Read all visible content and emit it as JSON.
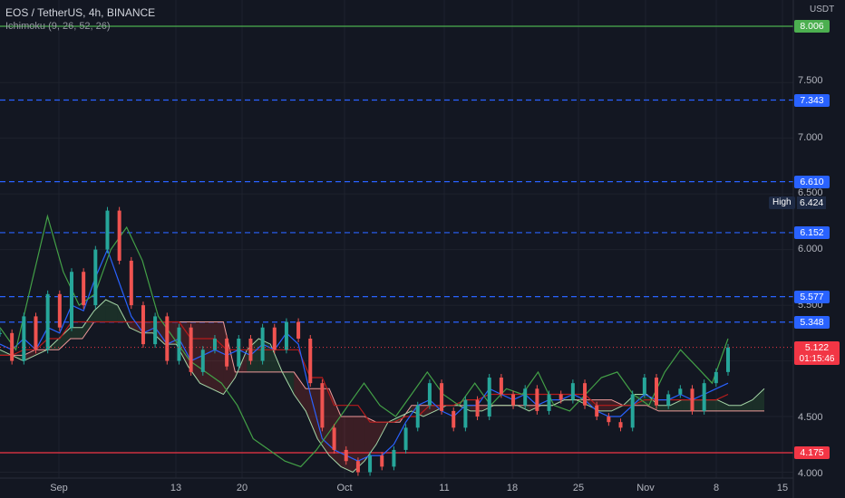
{
  "legend": {
    "symbol_line": "EOS / TetherUS, 4h, BINANCE",
    "indicator_line": "Ichimoku (9, 26, 52, 26)"
  },
  "price_scale": {
    "unit": "USDT",
    "ticks": [
      "7.500",
      "7.000",
      "6.500",
      "6.000",
      "5.500",
      "4.500",
      "4.000"
    ]
  },
  "time_scale": {
    "ticks": [
      "Sep",
      "13",
      "20",
      "Oct",
      "11",
      "18",
      "25",
      "Nov",
      "8",
      "15"
    ]
  },
  "high_marker": {
    "label": "High",
    "value": "6.424"
  },
  "last_price": {
    "value": "5.122",
    "countdown": "01:15:46"
  },
  "colors": {
    "background": "#131722",
    "blue_level": "#2962ff",
    "green_level": "#4caf50",
    "red_level": "#f23645",
    "tenkan": "#2962ff",
    "kijun": "#b71c1c",
    "chikou": "#43a047",
    "span_a": "#a5d6a7",
    "span_b": "#ef9a9a"
  },
  "chart_data": {
    "type": "line",
    "symbol": "EOS / TetherUS",
    "interval": "4h",
    "exchange": "BINANCE",
    "indicator": "Ichimoku (9, 26, 52, 26)",
    "y_unit": "USDT",
    "ylim": [
      3.98,
      8.2
    ],
    "x_ticks": [
      "Sep",
      "13",
      "20",
      "Oct",
      "11",
      "18",
      "25",
      "Nov",
      "8",
      "15"
    ],
    "grid": true,
    "horizontal_levels": [
      {
        "value": 8.006,
        "style": "solid",
        "color": "#4caf50"
      },
      {
        "value": 7.343,
        "style": "dashed",
        "color": "#2962ff"
      },
      {
        "value": 6.61,
        "style": "dashed",
        "color": "#2962ff"
      },
      {
        "value": 6.152,
        "style": "dashed",
        "color": "#2962ff"
      },
      {
        "value": 5.577,
        "style": "dashed",
        "color": "#2962ff"
      },
      {
        "value": 5.348,
        "style": "dashed",
        "color": "#2962ff"
      },
      {
        "value": 4.175,
        "style": "solid",
        "color": "#f23645"
      }
    ],
    "high": 6.424,
    "last_price": 5.122,
    "series": [
      {
        "key": "price",
        "values": [
          5.25,
          5.0,
          5.4,
          5.1,
          5.6,
          5.3,
          5.8,
          5.5,
          6.0,
          6.35,
          5.9,
          5.5,
          5.15,
          5.4,
          5.0,
          5.3,
          4.9,
          5.1,
          5.2,
          4.95,
          5.2,
          5.0,
          5.3,
          5.1,
          5.35,
          5.2,
          4.8,
          4.4,
          4.2,
          4.1,
          4.0,
          4.15,
          4.05,
          4.2,
          4.4,
          4.6,
          4.8,
          4.55,
          4.4,
          4.65,
          4.5,
          4.85,
          4.7,
          4.6,
          4.75,
          4.55,
          4.7,
          4.65,
          4.8,
          4.6,
          4.5,
          4.45,
          4.4,
          4.7,
          4.85,
          4.6,
          4.7,
          4.75,
          4.55,
          4.8,
          4.9,
          5.12
        ]
      },
      {
        "key": "tenkan",
        "values": [
          5.15,
          5.1,
          5.2,
          5.1,
          5.3,
          5.25,
          5.5,
          5.45,
          5.75,
          6.0,
          5.7,
          5.4,
          5.25,
          5.3,
          5.15,
          5.2,
          5.0,
          5.05,
          5.1,
          5.05,
          5.1,
          5.05,
          5.15,
          5.1,
          5.25,
          5.15,
          4.7,
          4.3,
          4.2,
          4.15,
          4.1,
          4.15,
          4.15,
          4.25,
          4.45,
          4.6,
          4.65,
          4.55,
          4.5,
          4.6,
          4.6,
          4.75,
          4.7,
          4.65,
          4.7,
          4.6,
          4.65,
          4.65,
          4.7,
          4.65,
          4.55,
          4.5,
          4.5,
          4.6,
          4.7,
          4.65,
          4.65,
          4.7,
          4.65,
          4.7,
          4.75,
          4.8
        ]
      },
      {
        "key": "kijun",
        "values": [
          5.05,
          5.05,
          5.1,
          5.1,
          5.2,
          5.2,
          5.35,
          5.35,
          5.35,
          5.35,
          5.35,
          5.35,
          5.35,
          5.35,
          5.35,
          5.35,
          5.2,
          5.2,
          5.2,
          5.1,
          5.1,
          5.1,
          5.1,
          5.1,
          5.1,
          5.1,
          4.85,
          4.85,
          4.6,
          4.6,
          4.6,
          4.45,
          4.45,
          4.45,
          4.5,
          4.5,
          4.6,
          4.6,
          4.6,
          4.65,
          4.65,
          4.7,
          4.7,
          4.7,
          4.7,
          4.7,
          4.7,
          4.7,
          4.7,
          4.7,
          4.6,
          4.6,
          4.6,
          4.6,
          4.65,
          4.65,
          4.65,
          4.65,
          4.65,
          4.65,
          4.65,
          4.7
        ]
      },
      {
        "key": "chikou",
        "values": [
          5.3,
          5.1,
          5.7,
          6.3,
          5.8,
          5.5,
          5.6,
          6.0,
          6.2,
          5.9,
          5.4,
          5.2,
          5.0,
          4.9,
          4.8,
          4.6,
          4.3,
          4.2,
          4.1,
          4.05,
          4.2,
          4.4,
          4.6,
          4.8,
          4.6,
          4.5,
          4.7,
          4.9,
          4.7,
          4.6,
          4.8,
          4.6,
          4.75,
          4.7,
          4.9,
          4.6,
          4.55,
          4.7,
          4.85,
          4.9,
          4.7,
          4.6,
          4.9,
          5.1,
          4.95,
          4.8,
          5.2
        ]
      },
      {
        "key": "span_a",
        "values": [
          5.1,
          5.05,
          5.0,
          5.05,
          5.1,
          5.2,
          5.3,
          5.3,
          5.45,
          5.55,
          5.5,
          5.3,
          5.25,
          5.25,
          5.15,
          5.15,
          4.95,
          4.8,
          4.75,
          4.7,
          4.85,
          5.1,
          5.2,
          5.15,
          4.9,
          4.7,
          4.55,
          4.3,
          4.15,
          4.05,
          4.0,
          4.1,
          4.25,
          4.45,
          4.5,
          4.55,
          4.5,
          4.55,
          4.6,
          4.6,
          4.55,
          4.55,
          4.6,
          4.6,
          4.6,
          4.55,
          4.6,
          4.6,
          4.65,
          4.65,
          4.6,
          4.55,
          4.55,
          4.6,
          4.7,
          4.7,
          4.6,
          4.6,
          4.65,
          4.65,
          4.65,
          4.65,
          4.6,
          4.6,
          4.65,
          4.75
        ]
      },
      {
        "key": "span_b",
        "values": [
          5.05,
          5.05,
          5.05,
          5.1,
          5.1,
          5.1,
          5.2,
          5.2,
          5.35,
          5.35,
          5.35,
          5.35,
          5.35,
          5.35,
          5.35,
          5.35,
          5.35,
          5.35,
          5.35,
          5.35,
          4.9,
          4.9,
          4.9,
          4.9,
          4.9,
          4.9,
          4.75,
          4.75,
          4.75,
          4.5,
          4.5,
          4.5,
          4.45,
          4.45,
          4.45,
          4.6,
          4.6,
          4.6,
          4.6,
          4.6,
          4.6,
          4.6,
          4.6,
          4.6,
          4.6,
          4.6,
          4.6,
          4.6,
          4.65,
          4.65,
          4.65,
          4.65,
          4.65,
          4.6,
          4.6,
          4.6,
          4.55,
          4.55,
          4.55,
          4.55,
          4.55,
          4.55,
          4.55,
          4.55,
          4.55,
          4.55
        ]
      }
    ]
  }
}
